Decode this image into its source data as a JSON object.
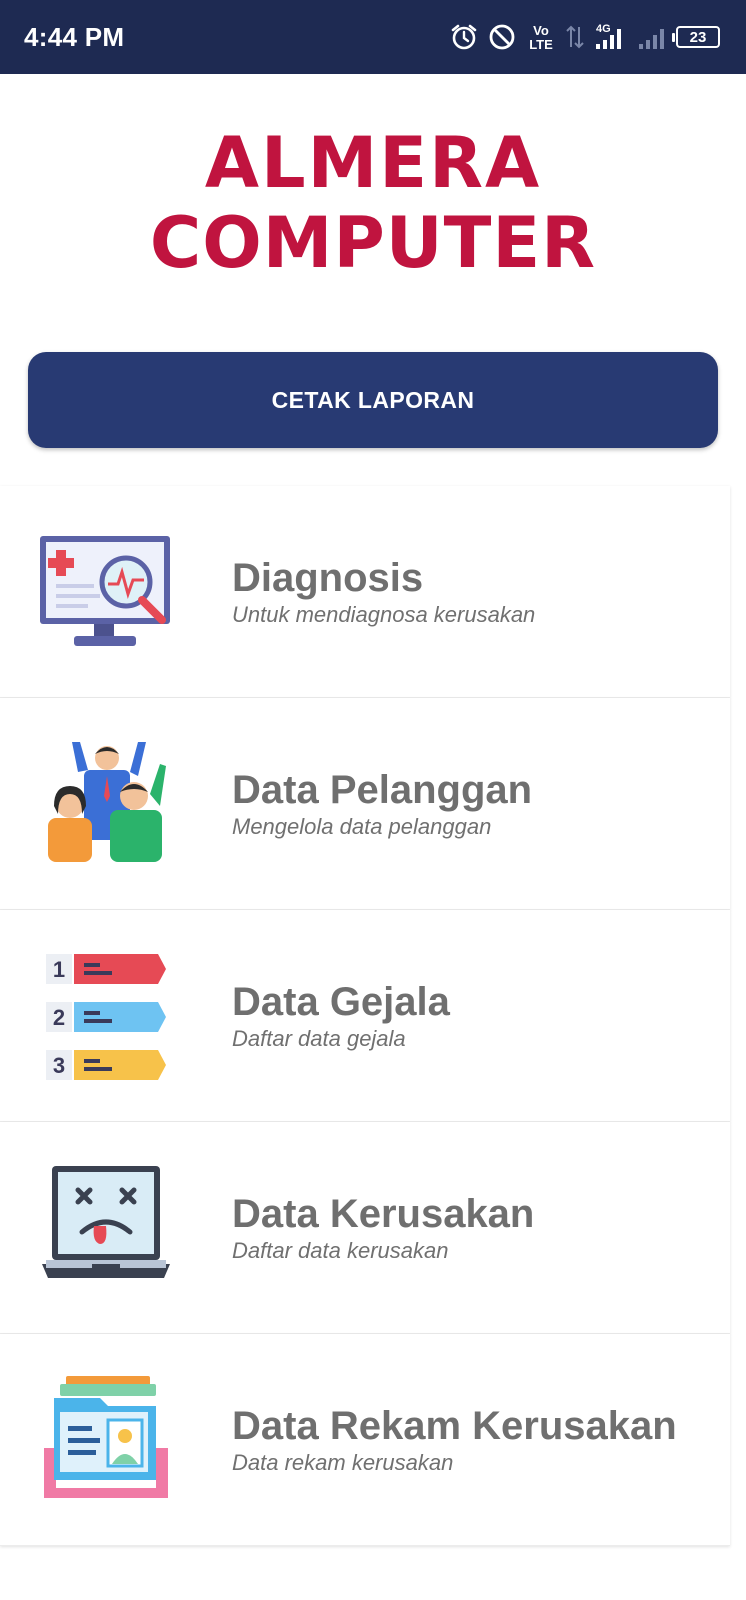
{
  "status_bar": {
    "time": "4:44 PM",
    "battery": "23",
    "icons": [
      "alarm-icon",
      "do-not-disturb-icon",
      "volte-icon",
      "data-arrows-icon",
      "signal-4g-icon",
      "signal-icon",
      "battery-icon"
    ],
    "volte_top": "Vo",
    "volte_bottom": "LTE",
    "network": "4G"
  },
  "logo": {
    "line1": "ALMERA",
    "line2": "COMPUTER",
    "color": "#c0143f"
  },
  "report_button": {
    "label": "CETAK LAPORAN",
    "color": "#283a73"
  },
  "menu": [
    {
      "title": "Diagnosis",
      "subtitle": "Untuk mendiagnosa kerusakan",
      "icon": "diagnosis-monitor-icon"
    },
    {
      "title": "Data Pelanggan",
      "subtitle": "Mengelola data pelanggan",
      "icon": "customers-group-icon"
    },
    {
      "title": "Data Gejala",
      "subtitle": "Daftar data gejala",
      "icon": "numbered-list-icon"
    },
    {
      "title": "Data Kerusakan",
      "subtitle": "Daftar data kerusakan",
      "icon": "broken-laptop-icon"
    },
    {
      "title": "Data Rekam Kerusakan",
      "subtitle": "Data rekam kerusakan",
      "icon": "record-folder-icon"
    }
  ]
}
